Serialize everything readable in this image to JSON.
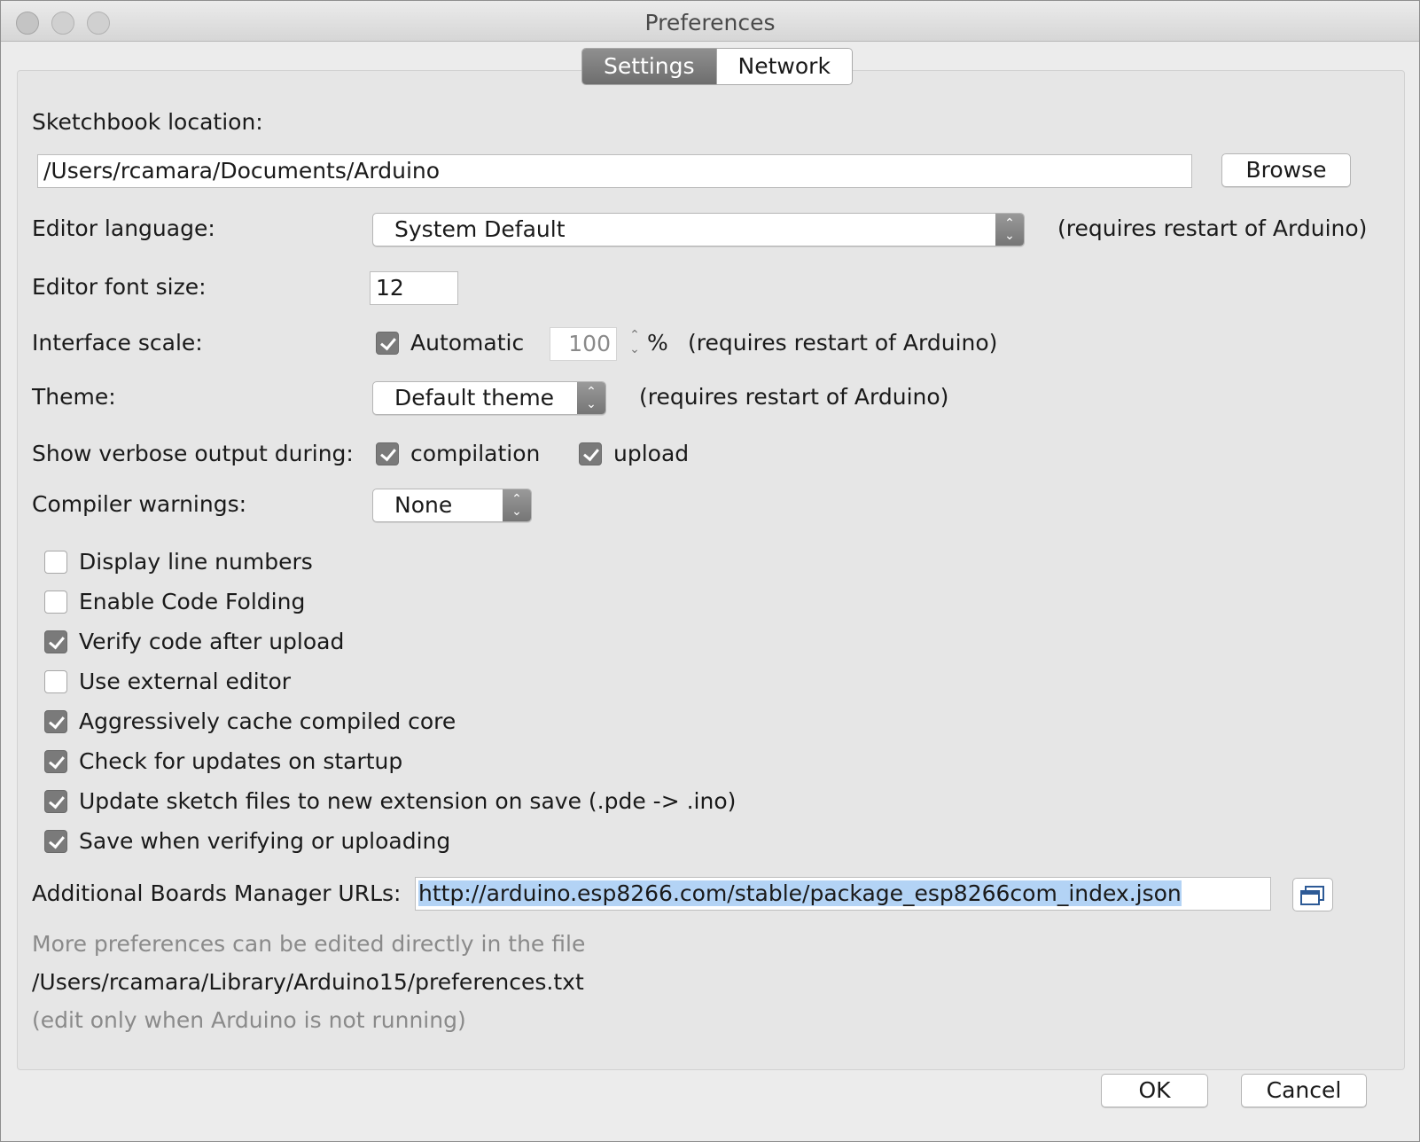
{
  "window": {
    "title": "Preferences"
  },
  "tabs": [
    {
      "label": "Settings",
      "active": true
    },
    {
      "label": "Network",
      "active": false
    }
  ],
  "sketchbook": {
    "label": "Sketchbook location:",
    "path": "/Users/rcamara/Documents/Arduino",
    "browse_label": "Browse"
  },
  "editor_language": {
    "label": "Editor language:",
    "value": "System Default",
    "note": "(requires restart of Arduino)"
  },
  "font_size": {
    "label": "Editor font size:",
    "value": "12"
  },
  "interface_scale": {
    "label": "Interface scale:",
    "auto_label": "Automatic",
    "auto_checked": true,
    "value": "100",
    "unit": "%",
    "note": "(requires restart of Arduino)"
  },
  "theme": {
    "label": "Theme:",
    "value": "Default theme",
    "note": "(requires restart of Arduino)"
  },
  "verbose": {
    "label": "Show verbose output during:",
    "compilation_label": "compilation",
    "compilation_checked": true,
    "upload_label": "upload",
    "upload_checked": true
  },
  "compiler_warnings": {
    "label": "Compiler warnings:",
    "value": "None"
  },
  "options": [
    {
      "label": "Display line numbers",
      "checked": false
    },
    {
      "label": "Enable Code Folding",
      "checked": false
    },
    {
      "label": "Verify code after upload",
      "checked": true
    },
    {
      "label": "Use external editor",
      "checked": false
    },
    {
      "label": "Aggressively cache compiled core",
      "checked": true
    },
    {
      "label": "Check for updates on startup",
      "checked": true
    },
    {
      "label": "Update sketch files to new extension on save (.pde -> .ino)",
      "checked": true
    },
    {
      "label": "Save when verifying or uploading",
      "checked": true
    }
  ],
  "boards": {
    "label": "Additional Boards Manager URLs:",
    "url": "http://arduino.esp8266.com/stable/package_esp8266com_index.json"
  },
  "footer": {
    "more_text": "More preferences can be edited directly in the file",
    "path": "/Users/rcamara/Library/Arduino15/preferences.txt",
    "hint": "(edit only when Arduino is not running)"
  },
  "buttons": {
    "ok": "OK",
    "cancel": "Cancel"
  }
}
